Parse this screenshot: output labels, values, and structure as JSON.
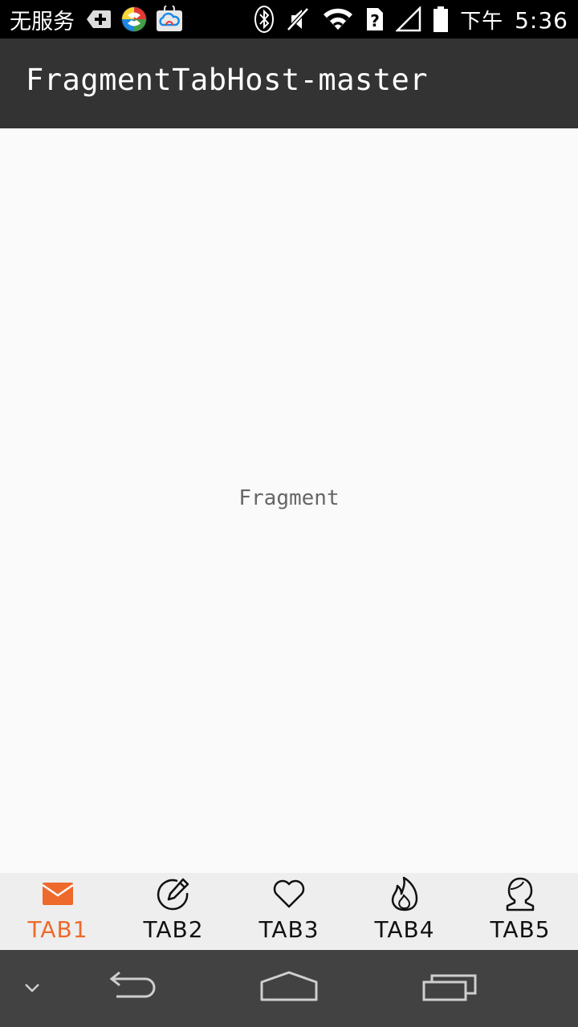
{
  "status_bar": {
    "carrier": "无服务",
    "time_period": "下午",
    "time": "5:36",
    "icons": [
      "add-notification-icon",
      "colorful-app-icon",
      "cloud-bag-icon",
      "bluetooth-icon",
      "mute-icon",
      "wifi-icon",
      "sim-unknown-icon",
      "signal-icon",
      "battery-icon"
    ]
  },
  "app_bar": {
    "title": "FragmentTabHost-master"
  },
  "content": {
    "text": "Fragment"
  },
  "tabs": [
    {
      "label": "TAB1",
      "icon": "mail-icon",
      "active": true
    },
    {
      "label": "TAB2",
      "icon": "edit-icon",
      "active": false
    },
    {
      "label": "TAB3",
      "icon": "heart-icon",
      "active": false
    },
    {
      "label": "TAB4",
      "icon": "fire-icon",
      "active": false
    },
    {
      "label": "TAB5",
      "icon": "person-icon",
      "active": false
    }
  ],
  "colors": {
    "accent": "#ee6a2c",
    "app_bar": "#333333",
    "tab_bar": "#eeeeee",
    "nav_bar": "#424242"
  },
  "nav_bar": {
    "icons": [
      "chevron-down-icon",
      "back-icon",
      "home-icon",
      "recents-icon"
    ]
  }
}
